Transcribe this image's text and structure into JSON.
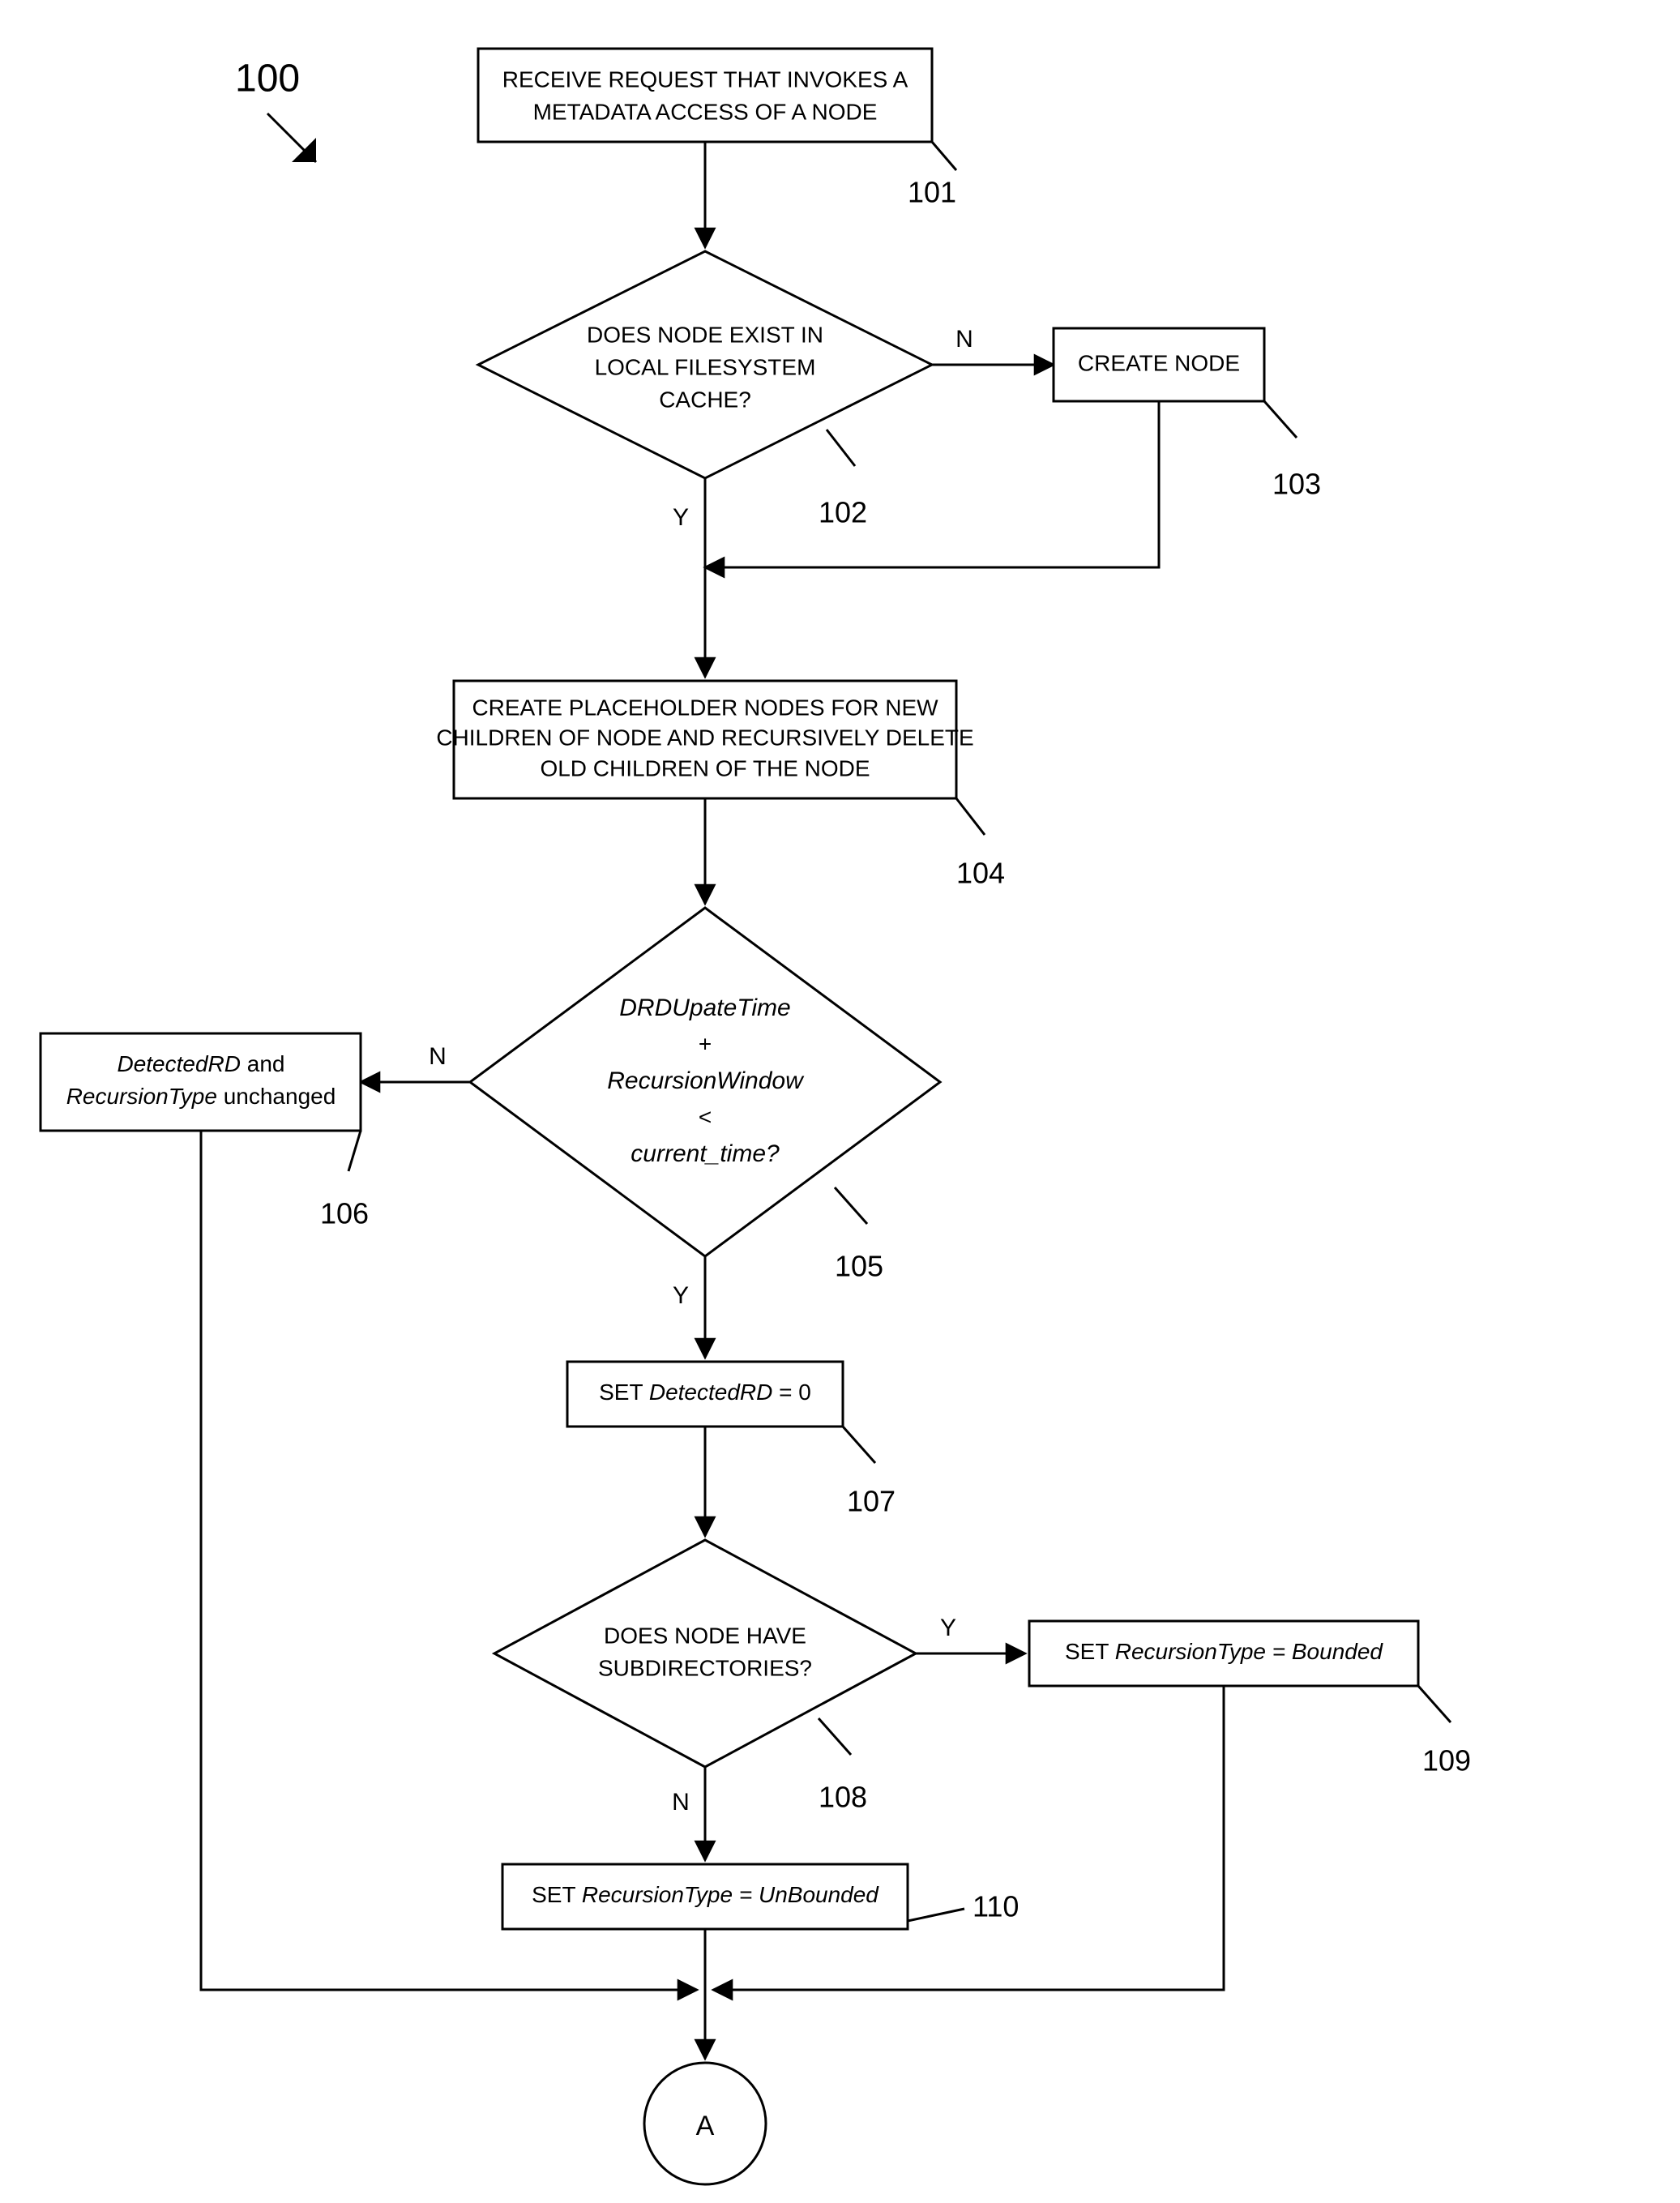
{
  "figureLabel": "100",
  "connector": "A",
  "labels": {
    "yes": "Y",
    "no": "N"
  },
  "nodes": {
    "n101": {
      "ref": "101",
      "lines": [
        "RECEIVE REQUEST THAT INVOKES A",
        "METADATA ACCESS OF A NODE"
      ]
    },
    "n102": {
      "ref": "102",
      "lines": [
        "DOES NODE EXIST IN",
        "LOCAL FILESYSTEM",
        "CACHE?"
      ]
    },
    "n103": {
      "ref": "103",
      "lines": [
        "CREATE NODE"
      ]
    },
    "n104": {
      "ref": "104",
      "lines": [
        "CREATE PLACEHOLDER NODES FOR NEW",
        "CHILDREN OF NODE AND RECURSIVELY DELETE",
        "OLD CHILDREN OF THE  NODE"
      ]
    },
    "n105": {
      "ref": "105",
      "lines": [
        "DRDUpateTime",
        "+",
        "RecursionWindow",
        "<",
        "current_time?"
      ]
    },
    "n106": {
      "ref": "106",
      "lines": [
        "DetectedRD",
        " and",
        "RecursionType",
        " unchanged"
      ]
    },
    "n107": {
      "ref": "107",
      "prefix": "SET ",
      "var": "DetectedRD",
      "suffix": " = 0"
    },
    "n108": {
      "ref": "108",
      "lines": [
        "DOES NODE HAVE",
        "SUBDIRECTORIES?"
      ]
    },
    "n109": {
      "ref": "109",
      "prefix": "SET ",
      "var": "RecursionType = Bounded"
    },
    "n110": {
      "ref": "110",
      "prefix": "SET ",
      "var": "RecursionType = UnBounded"
    }
  }
}
